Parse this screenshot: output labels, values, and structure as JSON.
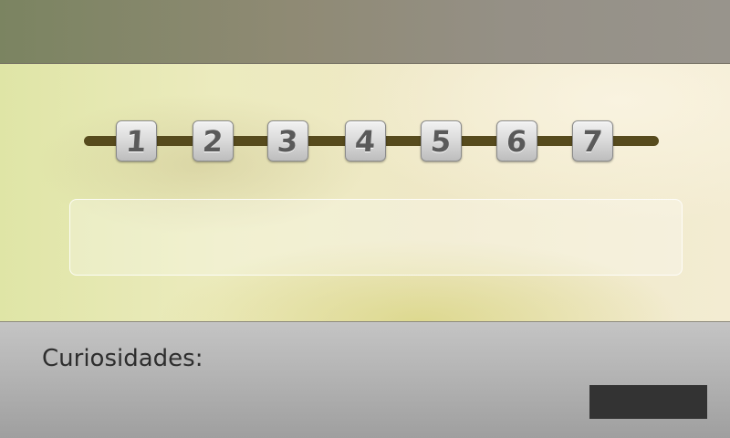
{
  "steps": [
    {
      "label": "1"
    },
    {
      "label": "2"
    },
    {
      "label": "3"
    },
    {
      "label": "4"
    },
    {
      "label": "5"
    },
    {
      "label": "6"
    },
    {
      "label": "7"
    }
  ],
  "text_panel": {
    "content": ""
  },
  "bottom": {
    "label": "Curiosidades:",
    "button_label": ""
  },
  "colors": {
    "timeline_line": "#574b1d",
    "bottom_button": "#333333",
    "step_text": "#5a5a5a"
  }
}
